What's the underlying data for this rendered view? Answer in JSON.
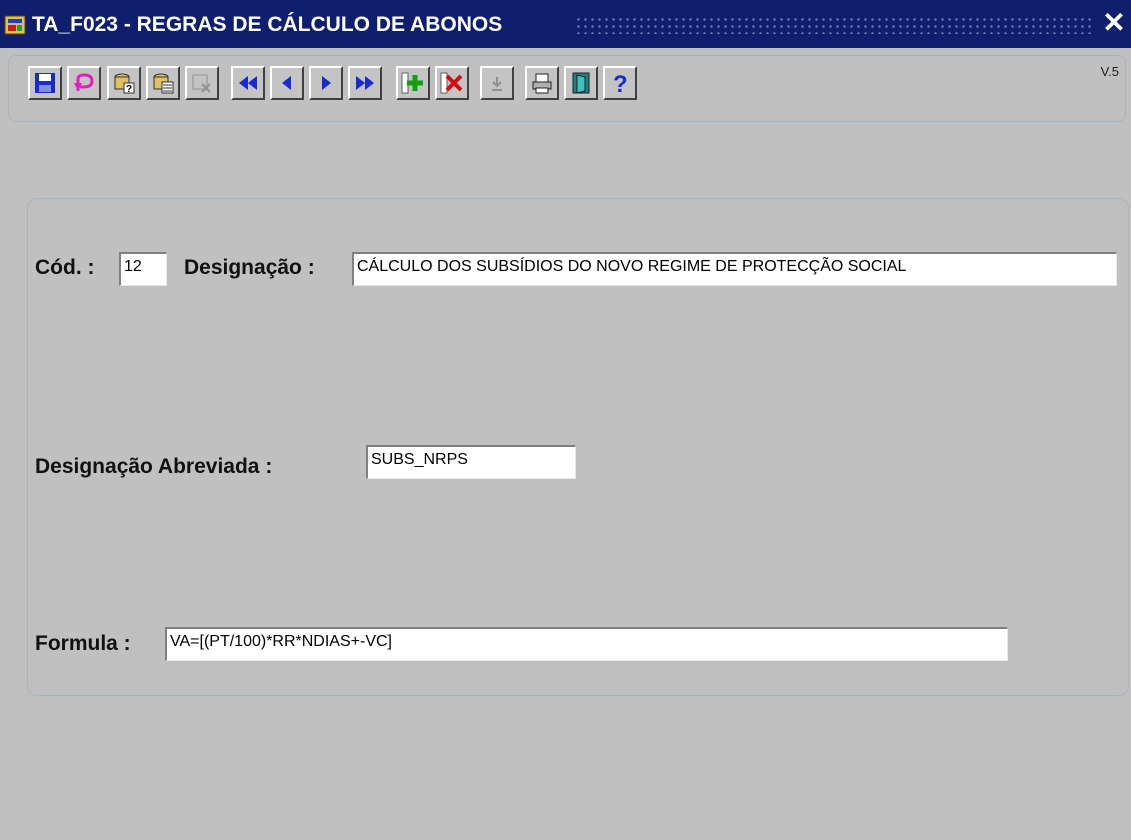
{
  "window": {
    "title": "TA_F023 - REGRAS DE CÁLCULO DE ABONOS",
    "close_glyph": "✕",
    "app_icon": "forms-app-icon"
  },
  "toolbar": {
    "version": "V.5",
    "buttons": [
      {
        "name": "save-button",
        "icon": "floppy-disk-icon"
      },
      {
        "name": "undo-button",
        "icon": "undo-arrow-icon"
      },
      {
        "name": "enter-query-button",
        "icon": "query-icon"
      },
      {
        "name": "execute-query-button",
        "icon": "execute-query-icon"
      },
      {
        "name": "cancel-query-button",
        "icon": "cancel-query-icon"
      },
      {
        "name": "first-record-button",
        "icon": "first-record-icon"
      },
      {
        "name": "previous-record-button",
        "icon": "previous-record-icon"
      },
      {
        "name": "next-record-button",
        "icon": "next-record-icon"
      },
      {
        "name": "last-record-button",
        "icon": "last-record-icon"
      },
      {
        "name": "insert-record-button",
        "icon": "plus-icon"
      },
      {
        "name": "delete-record-button",
        "icon": "delete-x-icon"
      },
      {
        "name": "duplicate-button",
        "icon": "duplicate-icon"
      },
      {
        "name": "print-button",
        "icon": "printer-icon"
      },
      {
        "name": "exit-button",
        "icon": "exit-door-icon"
      },
      {
        "name": "help-button",
        "icon": "help-question-icon"
      }
    ]
  },
  "form": {
    "cod_label": "Cód. :",
    "cod_value": "12",
    "designacao_label": "Designação :",
    "designacao_value": "CÁLCULO DOS SUBSÍDIOS DO NOVO REGIME DE PROTECÇÃO SOCIAL",
    "abreviada_label": "Designação Abreviada :",
    "abreviada_value": "SUBS_NRPS",
    "formula_label": "Formula :",
    "formula_value": "VA=[(PT/100)*RR*NDIAS+-VC]"
  },
  "colors": {
    "titlebar": "#0f1f6e",
    "background": "#c0c0c0",
    "nav_blue": "#1a2ad0",
    "delete_red": "#d01010",
    "insert_green": "#10a010"
  }
}
